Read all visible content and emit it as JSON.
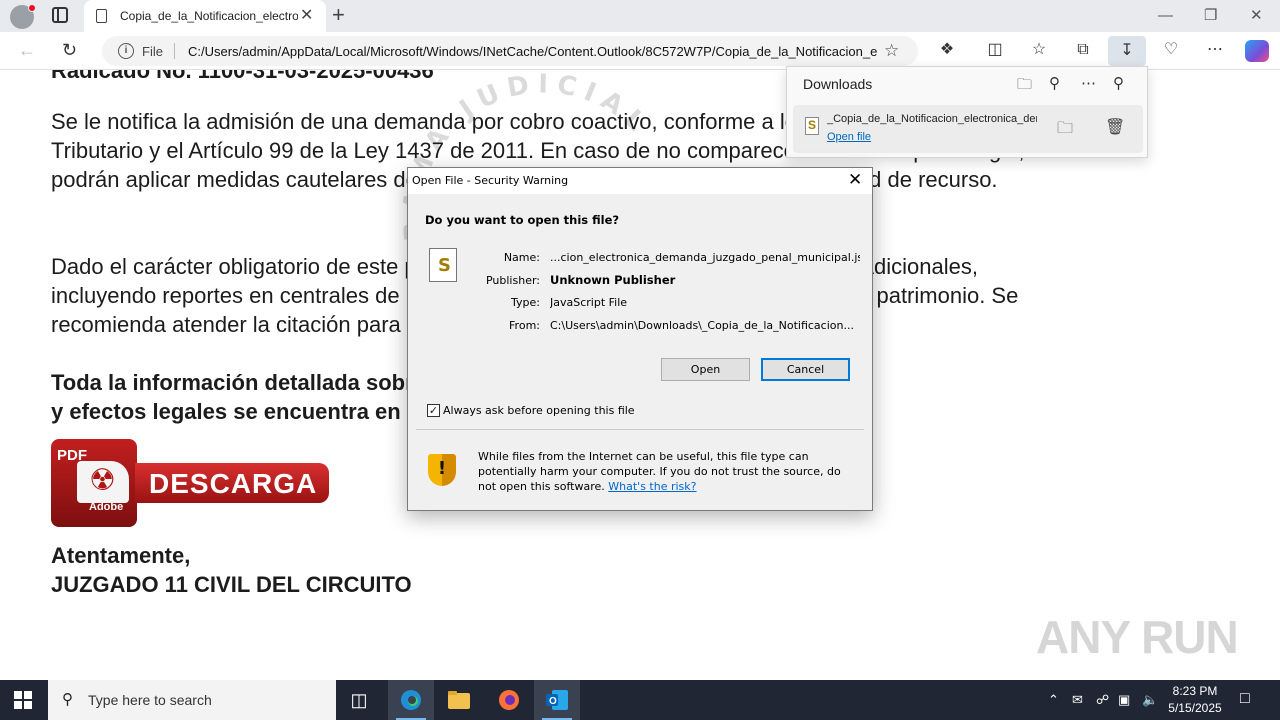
{
  "browser": {
    "tab_title": "Copia_de_la_Notificacion_electronica_demanda_juzgado_penal_municipal",
    "tab_close": "✕",
    "new_tab": "+",
    "address_scheme": "File",
    "address_url": "C:/Users/admin/AppData/Local/Microsoft/Windows/INetCache/Content.Outlook/8C572W7P/Copia_de_la_Notificacion_electronica_demanda_juzgado_penal_municipal.html",
    "window_minimize": "—",
    "window_restore": "❐",
    "window_close": "✕"
  },
  "page": {
    "cut_line": "Radicado No. 1100-31-03-2025-00436",
    "para1": "Se le notifica la admisión de una demanda por cobro coactivo, conforme a lo dispuesto en el Estatuto Tributario y el Artículo 99 de la Ley 1437 de 2011. En caso de no comparecer dentro del plazo legal, se podrán aplicar medidas cautelares de embargo y secuestro de bienes, sin posibilidad de recurso.",
    "para2": "Dado el carácter obligatorio de este proceso, la omisión podría acarrear sanciones adicionales, incluyendo reportes en centrales de riesgo y medidas de ejecución forzosa sobre su patrimonio. Se recomienda atender la citación para evitar perjuicios legales mayores.",
    "bold_line1": "Toda la información detallada sobre la demanda",
    "bold_line2": "y efectos legales se encuentra en el archivo adjunto:",
    "pdf_tag": "PDF",
    "pdf_adobe": "Adobe",
    "descarga": "DESCARGA",
    "sign1": "Atentamente,",
    "sign2": "JUZGADO 11 CIVIL DEL CIRCUITO",
    "watermark": "RAMA JUDICIAL",
    "anyrun": "ANY RUN"
  },
  "downloads": {
    "title": "Downloads",
    "file_name": "_Copia_de_la_Notificacion_electronica_demanda_juzgado_penal_municipal.js",
    "open_link": "Open file"
  },
  "dialog": {
    "title": "Open File - Security Warning",
    "close": "✕",
    "question": "Do you want to open this file?",
    "name_label": "Name:",
    "name_value": "...cion_electronica_demanda_juzgado_penal_municipal.js",
    "publisher_label": "Publisher:",
    "publisher_value": "Unknown Publisher",
    "type_label": "Type:",
    "type_value": "JavaScript File",
    "from_label": "From:",
    "from_value": "C:\\Users\\admin\\Downloads\\_Copia_de_la_Notificacion...",
    "open_button": "Open",
    "cancel_button": "Cancel",
    "checkbox_label": "Always ask before opening this file",
    "checkbox_checked": true,
    "warning_text": "While files from the Internet can be useful, this file type can potentially harm your computer. If you do not trust the source, do not open this software.",
    "warning_link": "What's the risk?"
  },
  "taskbar": {
    "search_placeholder": "Type here to search",
    "time": "8:23 PM",
    "date": "5/15/2025"
  },
  "colors": {
    "accent": "#0078d7",
    "pdf_red": "#c21f1f",
    "taskbar": "#202633"
  }
}
